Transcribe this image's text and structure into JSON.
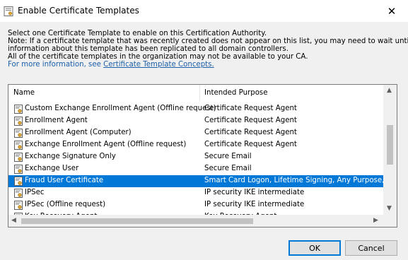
{
  "window": {
    "title": "Enable Certificate Templates",
    "close_glyph": "✕"
  },
  "description": {
    "lines": [
      "Select one Certificate Template to enable on this Certification Authority.",
      "Note: If a certificate template that was recently created does not appear on this list, you may need to wait until",
      "information about this template has been replicated to all domain controllers.",
      "All of the certificate templates in the organization may not be available to your CA."
    ],
    "more_info_prefix": "For more information, see ",
    "more_info_link": "Certificate Template Concepts."
  },
  "list": {
    "columns": [
      "Name",
      "Intended Purpose"
    ],
    "rows": [
      {
        "name": "Custom Exchange Enrollment Agent (Offline request)",
        "purpose": "Certificate Request Agent",
        "selected": false
      },
      {
        "name": "Enrollment Agent",
        "purpose": "Certificate Request Agent",
        "selected": false
      },
      {
        "name": "Enrollment Agent (Computer)",
        "purpose": "Certificate Request Agent",
        "selected": false
      },
      {
        "name": "Exchange Enrollment Agent (Offline request)",
        "purpose": "Certificate Request Agent",
        "selected": false
      },
      {
        "name": "Exchange Signature Only",
        "purpose": "Secure Email",
        "selected": false
      },
      {
        "name": "Exchange User",
        "purpose": "Secure Email",
        "selected": false
      },
      {
        "name": "Fraud User Certificate",
        "purpose": "Smart Card Logon, Lifetime Signing, Any Purpose, Cle",
        "selected": true
      },
      {
        "name": "IPSec",
        "purpose": "IP security IKE intermediate",
        "selected": false
      },
      {
        "name": "IPSec (Offline request)",
        "purpose": "IP security IKE intermediate",
        "selected": false
      },
      {
        "name": "Key Recovery Agent",
        "purpose": "Key Recovery Agent",
        "selected": false
      }
    ],
    "row_icon": "certificate-template-icon"
  },
  "buttons": {
    "ok": "OK",
    "cancel": "Cancel"
  },
  "colors": {
    "selection": "#0078d7",
    "link": "#1a5ea8"
  }
}
